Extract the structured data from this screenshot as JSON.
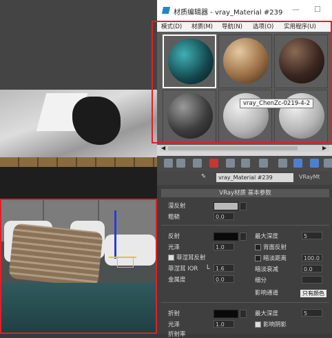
{
  "window": {
    "title": "材质编辑器 - vray_Material #239",
    "menus": [
      "模式(D)",
      "材质(M)",
      "导航(N)",
      "选项(O)",
      "实用程序(U)"
    ]
  },
  "slots": {
    "tooltip": "vray_ChenZc-0219-4-2",
    "items": [
      {
        "icon": "teal-speckled-sphere"
      },
      {
        "icon": "wood-sphere"
      },
      {
        "icon": "dark-wood-sphere"
      },
      {
        "icon": "dark-gray-sphere"
      },
      {
        "icon": "gray-sphere"
      },
      {
        "icon": "gray-sphere"
      }
    ]
  },
  "material": {
    "name": "vray_Material #239",
    "type": "VRayMt"
  },
  "params": {
    "rollout_title": "VRay材质 基本参数",
    "diffuse_label": "漫反射",
    "roughness_label": "粗糙",
    "roughness_value": "0.0",
    "reflect_label": "反射",
    "gloss_label": "光泽",
    "gloss_value": "1.0",
    "fresnel_label": "菲涅耳反射",
    "fresnel_ior_label": "菲涅耳 IOR",
    "fresnel_ior_short": "L",
    "fresnel_ior_value": "1.6",
    "metal_label": "金属度",
    "metal_value": "0.0",
    "max_depth_label": "最大深度",
    "max_depth_value": "5",
    "back_reflect_label": "背面反射",
    "dim_dist_label": "暗淡距离",
    "dim_dist_value": "100.0",
    "dim_falloff_label": "暗淡衰减",
    "dim_falloff_value": "0.0",
    "subdiv_label": "细分",
    "affect_channels_label": "影响通道",
    "affect_channels_value": "只有颜色",
    "refract_label": "折射",
    "refract_gloss_label": "光泽",
    "refract_gloss_value": "1.0",
    "ior_label": "折射率",
    "refract_max_depth_label": "最大深度",
    "refract_max_depth_value": "5",
    "affect_shadows_label": "影响阴影"
  },
  "colors": {
    "accent_red": "#e0202a",
    "selection": "#ffffff"
  }
}
